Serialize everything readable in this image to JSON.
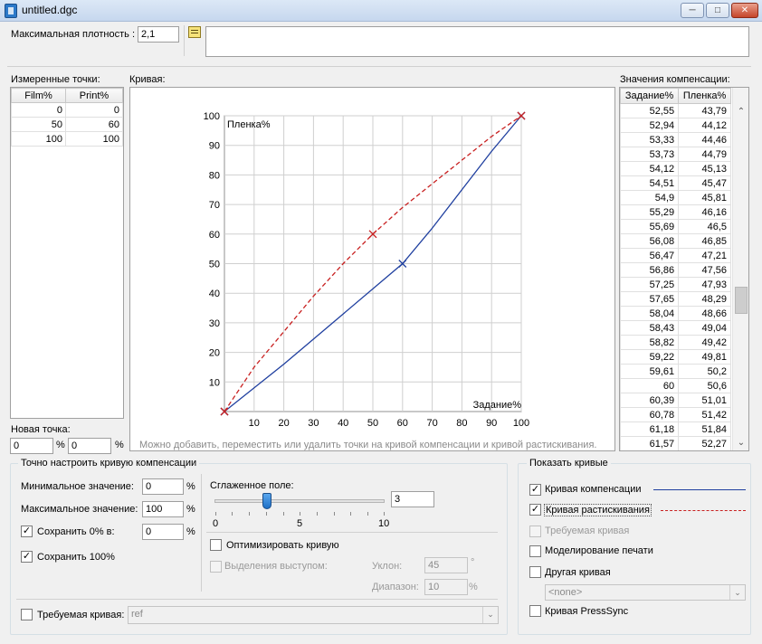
{
  "window": {
    "title": "untitled.dgc"
  },
  "top": {
    "max_density_label": "Максимальная плотность :",
    "max_density_value": "2,1"
  },
  "measured": {
    "label": "Измеренные точки:",
    "columns": [
      "Film%",
      "Print%"
    ],
    "rows": [
      [
        "0",
        "0"
      ],
      [
        "50",
        "60"
      ],
      [
        "100",
        "100"
      ]
    ]
  },
  "new_point": {
    "label": "Новая точка:",
    "film_value": "0",
    "print_value": "0",
    "unit": "%"
  },
  "chart": {
    "label": "Кривая:",
    "hint": "Можно добавить, переместить или удалить точки на кривой компенсации и кривой растискивания."
  },
  "chart_data": {
    "type": "line",
    "title": "",
    "xlabel": "Задание%",
    "ylabel": "Пленка%",
    "xlim": [
      0,
      100
    ],
    "ylim": [
      0,
      100
    ],
    "xticks": [
      "10",
      "20",
      "30",
      "40",
      "50",
      "60",
      "70",
      "80",
      "90",
      "100"
    ],
    "yticks": [
      "10",
      "20",
      "30",
      "40",
      "50",
      "60",
      "70",
      "80",
      "90",
      "100"
    ],
    "grid": true,
    "series": [
      {
        "style": "solid",
        "color": "#1f3f9f",
        "x": [
          0,
          20,
          40,
          60,
          70,
          80,
          90,
          100
        ],
        "y": [
          0,
          16,
          33,
          50,
          62,
          75,
          88,
          100
        ],
        "markers_x": [
          0,
          60,
          100
        ],
        "markers_y": [
          0,
          50,
          100
        ]
      },
      {
        "style": "dashed",
        "color": "#c82020",
        "x": [
          0,
          10,
          20,
          30,
          40,
          50,
          60,
          70,
          80,
          90,
          100
        ],
        "y": [
          0,
          15,
          27,
          39,
          50,
          60,
          69,
          77,
          85,
          93,
          100
        ],
        "markers_x": [
          0,
          50,
          100
        ],
        "markers_y": [
          0,
          60,
          100
        ]
      }
    ]
  },
  "compensation": {
    "label": "Значения компенсации:",
    "columns": [
      "Задание%",
      "Пленка%"
    ],
    "rows": [
      [
        "52,55",
        "43,79"
      ],
      [
        "52,94",
        "44,12"
      ],
      [
        "53,33",
        "44,46"
      ],
      [
        "53,73",
        "44,79"
      ],
      [
        "54,12",
        "45,13"
      ],
      [
        "54,51",
        "45,47"
      ],
      [
        "54,9",
        "45,81"
      ],
      [
        "55,29",
        "46,16"
      ],
      [
        "55,69",
        "46,5"
      ],
      [
        "56,08",
        "46,85"
      ],
      [
        "56,47",
        "47,21"
      ],
      [
        "56,86",
        "47,56"
      ],
      [
        "57,25",
        "47,93"
      ],
      [
        "57,65",
        "48,29"
      ],
      [
        "58,04",
        "48,66"
      ],
      [
        "58,43",
        "49,04"
      ],
      [
        "58,82",
        "49,42"
      ],
      [
        "59,22",
        "49,81"
      ],
      [
        "59,61",
        "50,2"
      ],
      [
        "60",
        "50,6"
      ],
      [
        "60,39",
        "51,01"
      ],
      [
        "60,78",
        "51,42"
      ],
      [
        "61,18",
        "51,84"
      ],
      [
        "61,57",
        "52,27"
      ]
    ]
  },
  "fine_tune": {
    "title": "Точно настроить кривую компенсации",
    "min_label": "Минимальное значение:",
    "min_value": "0",
    "max_label": "Максимальное значение:",
    "max_value": "100",
    "keep0_label": "Сохранить 0% в:",
    "keep0_value": "0",
    "keep100_label": "Сохранить 100%",
    "unit": "%",
    "smooth_label": "Сглаженное поле:",
    "smooth_value": "3",
    "slider_ticks": [
      "0",
      "5",
      "10"
    ],
    "optimize_label": "Оптимизировать кривую",
    "bump_label": "Выделения выступом:",
    "slope_label": "Уклон:",
    "slope_value": "45",
    "slope_unit": "°",
    "range_label": "Диапазон:",
    "range_value": "10",
    "range_unit": "%",
    "required_label": "Требуемая кривая:",
    "required_value": "ref"
  },
  "show": {
    "title": "Показать кривые",
    "comp_label": "Кривая компенсации",
    "dot_label": "Кривая растискивания",
    "required_label": "Требуемая кривая",
    "model_label": "Моделирование печати",
    "other_label": "Другая кривая",
    "other_value": "<none>",
    "presssync_label": "Кривая PressSync"
  },
  "colors": {
    "comp_line": "#1f3f9f",
    "dot_line": "#c82020"
  }
}
